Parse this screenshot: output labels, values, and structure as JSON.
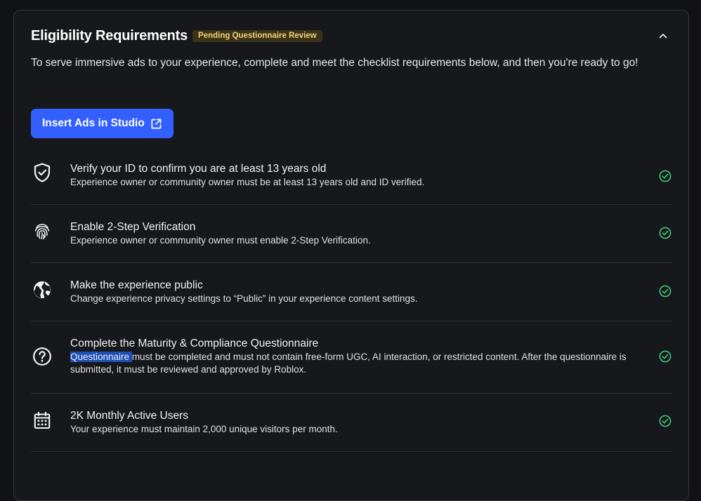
{
  "header": {
    "title": "Eligibility Requirements",
    "badge": "Pending Questionnaire Review"
  },
  "intro": "To serve immersive ads to your experience, complete and meet the checklist requirements below, and then you're ready to go!",
  "cta": {
    "label": "Insert Ads in Studio",
    "icon": "external-link-icon"
  },
  "requirements": [
    {
      "icon": "shield-check-icon",
      "title": "Verify your ID to confirm you are at least 13 years old",
      "description": "Experience owner or community owner must be at least 13 years old and ID verified.",
      "status": "complete"
    },
    {
      "icon": "fingerprint-icon",
      "title": "Enable 2-Step Verification",
      "description": "Experience owner or community owner must enable 2-Step Verification.",
      "status": "complete"
    },
    {
      "icon": "globe-icon",
      "title": "Make the experience public",
      "description": "Change experience privacy settings to “Public” in your experience content settings.",
      "status": "complete"
    },
    {
      "icon": "question-circle-icon",
      "title": "Complete the Maturity & Compliance Questionnaire",
      "description_selected": "Questionnaire ",
      "description_rest": "must be completed and must not contain free-form UGC, AI interaction, or restricted content. After the questionnaire is submitted, it must be reviewed and approved by Roblox.",
      "status": "complete"
    },
    {
      "icon": "calendar-icon",
      "title": "2K Monthly Active Users",
      "description": "Your experience must maintain 2,000 unique visitors per month.",
      "status": "complete"
    }
  ],
  "colors": {
    "background": "#111216",
    "panel": "#17181c",
    "accent": "#335fff",
    "badge_bg": "#3a3318",
    "badge_text": "#f3d27a",
    "success": "#3ec774"
  }
}
